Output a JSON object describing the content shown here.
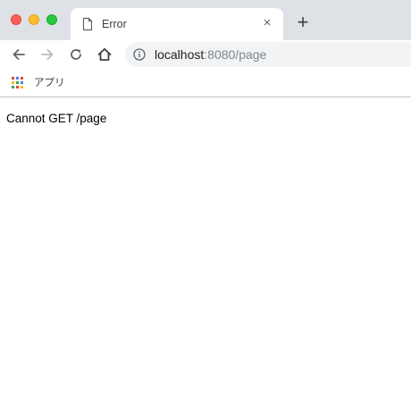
{
  "window": {
    "controls": {
      "close_color": "#ff5f57",
      "minimize_color": "#febc2e",
      "maximize_color": "#28c840"
    }
  },
  "tab": {
    "title": "Error",
    "icon": "document-icon",
    "close_glyph": "×",
    "new_tab_glyph": "+"
  },
  "toolbar": {
    "back_icon": "arrow-left-icon",
    "forward_icon": "arrow-right-icon",
    "reload_icon": "reload-icon",
    "home_icon": "home-icon",
    "address": {
      "site_info_icon": "info-icon",
      "host": "localhost",
      "rest": ":8080/page"
    }
  },
  "bookmarks": {
    "apps_label": "アプリ",
    "apps_icon": "apps-grid-icon"
  },
  "page": {
    "body_text": "Cannot GET /page"
  }
}
